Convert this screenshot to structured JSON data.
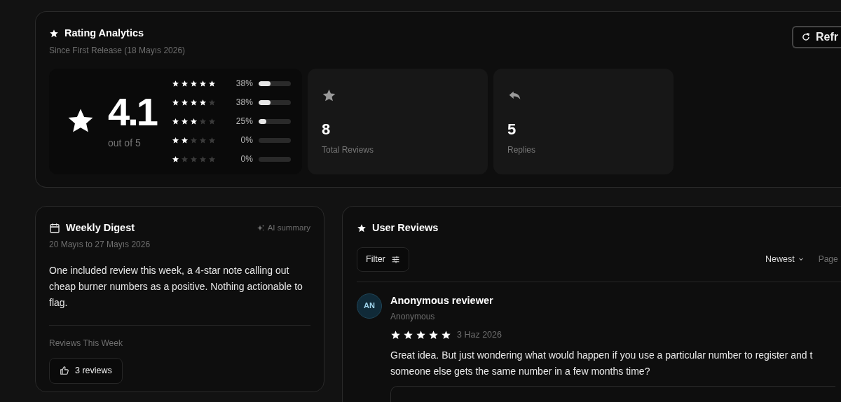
{
  "rating_analytics": {
    "title": "Rating Analytics",
    "subtitle": "Since First Release (18 Mayıs 2026)",
    "refresh_button": "Refr",
    "average": "4.1",
    "out_of": "out of 5",
    "distribution": [
      {
        "stars": 5,
        "percent": "38%",
        "level": 0.38
      },
      {
        "stars": 4,
        "percent": "38%",
        "level": 0.38
      },
      {
        "stars": 3,
        "percent": "25%",
        "level": 0.25
      },
      {
        "stars": 2,
        "percent": "0%",
        "level": 0
      },
      {
        "stars": 1,
        "percent": "0%",
        "level": 0
      }
    ],
    "stats": [
      {
        "kind": "star",
        "value": "8",
        "label": "Total Reviews"
      },
      {
        "kind": "reply",
        "value": "5",
        "label": "Replies"
      }
    ]
  },
  "weekly_digest": {
    "title": "Weekly Digest",
    "badge": "AI summary",
    "date_range": "20 Mayıs to 27 Mayıs 2026",
    "summary": "One included review this week, a 4-star note calling out cheap burner numbers as a positive. Nothing actionable to flag.",
    "section_label": "Reviews This Week",
    "count_chip": "3 reviews"
  },
  "user_reviews": {
    "title": "User Reviews",
    "filter_button": "Filter",
    "sort": "Newest",
    "page_label": "Page",
    "reviews": [
      {
        "initials": "AN",
        "name": "Anonymous reviewer",
        "subtitle": "Anonymous",
        "stars": 5,
        "date": "3 Haz 2026",
        "text_lines": [
          "Great idea. But just wondering what would happen if you use a particular number to register and t",
          "someone else gets the same number in a few months time?"
        ]
      }
    ]
  }
}
